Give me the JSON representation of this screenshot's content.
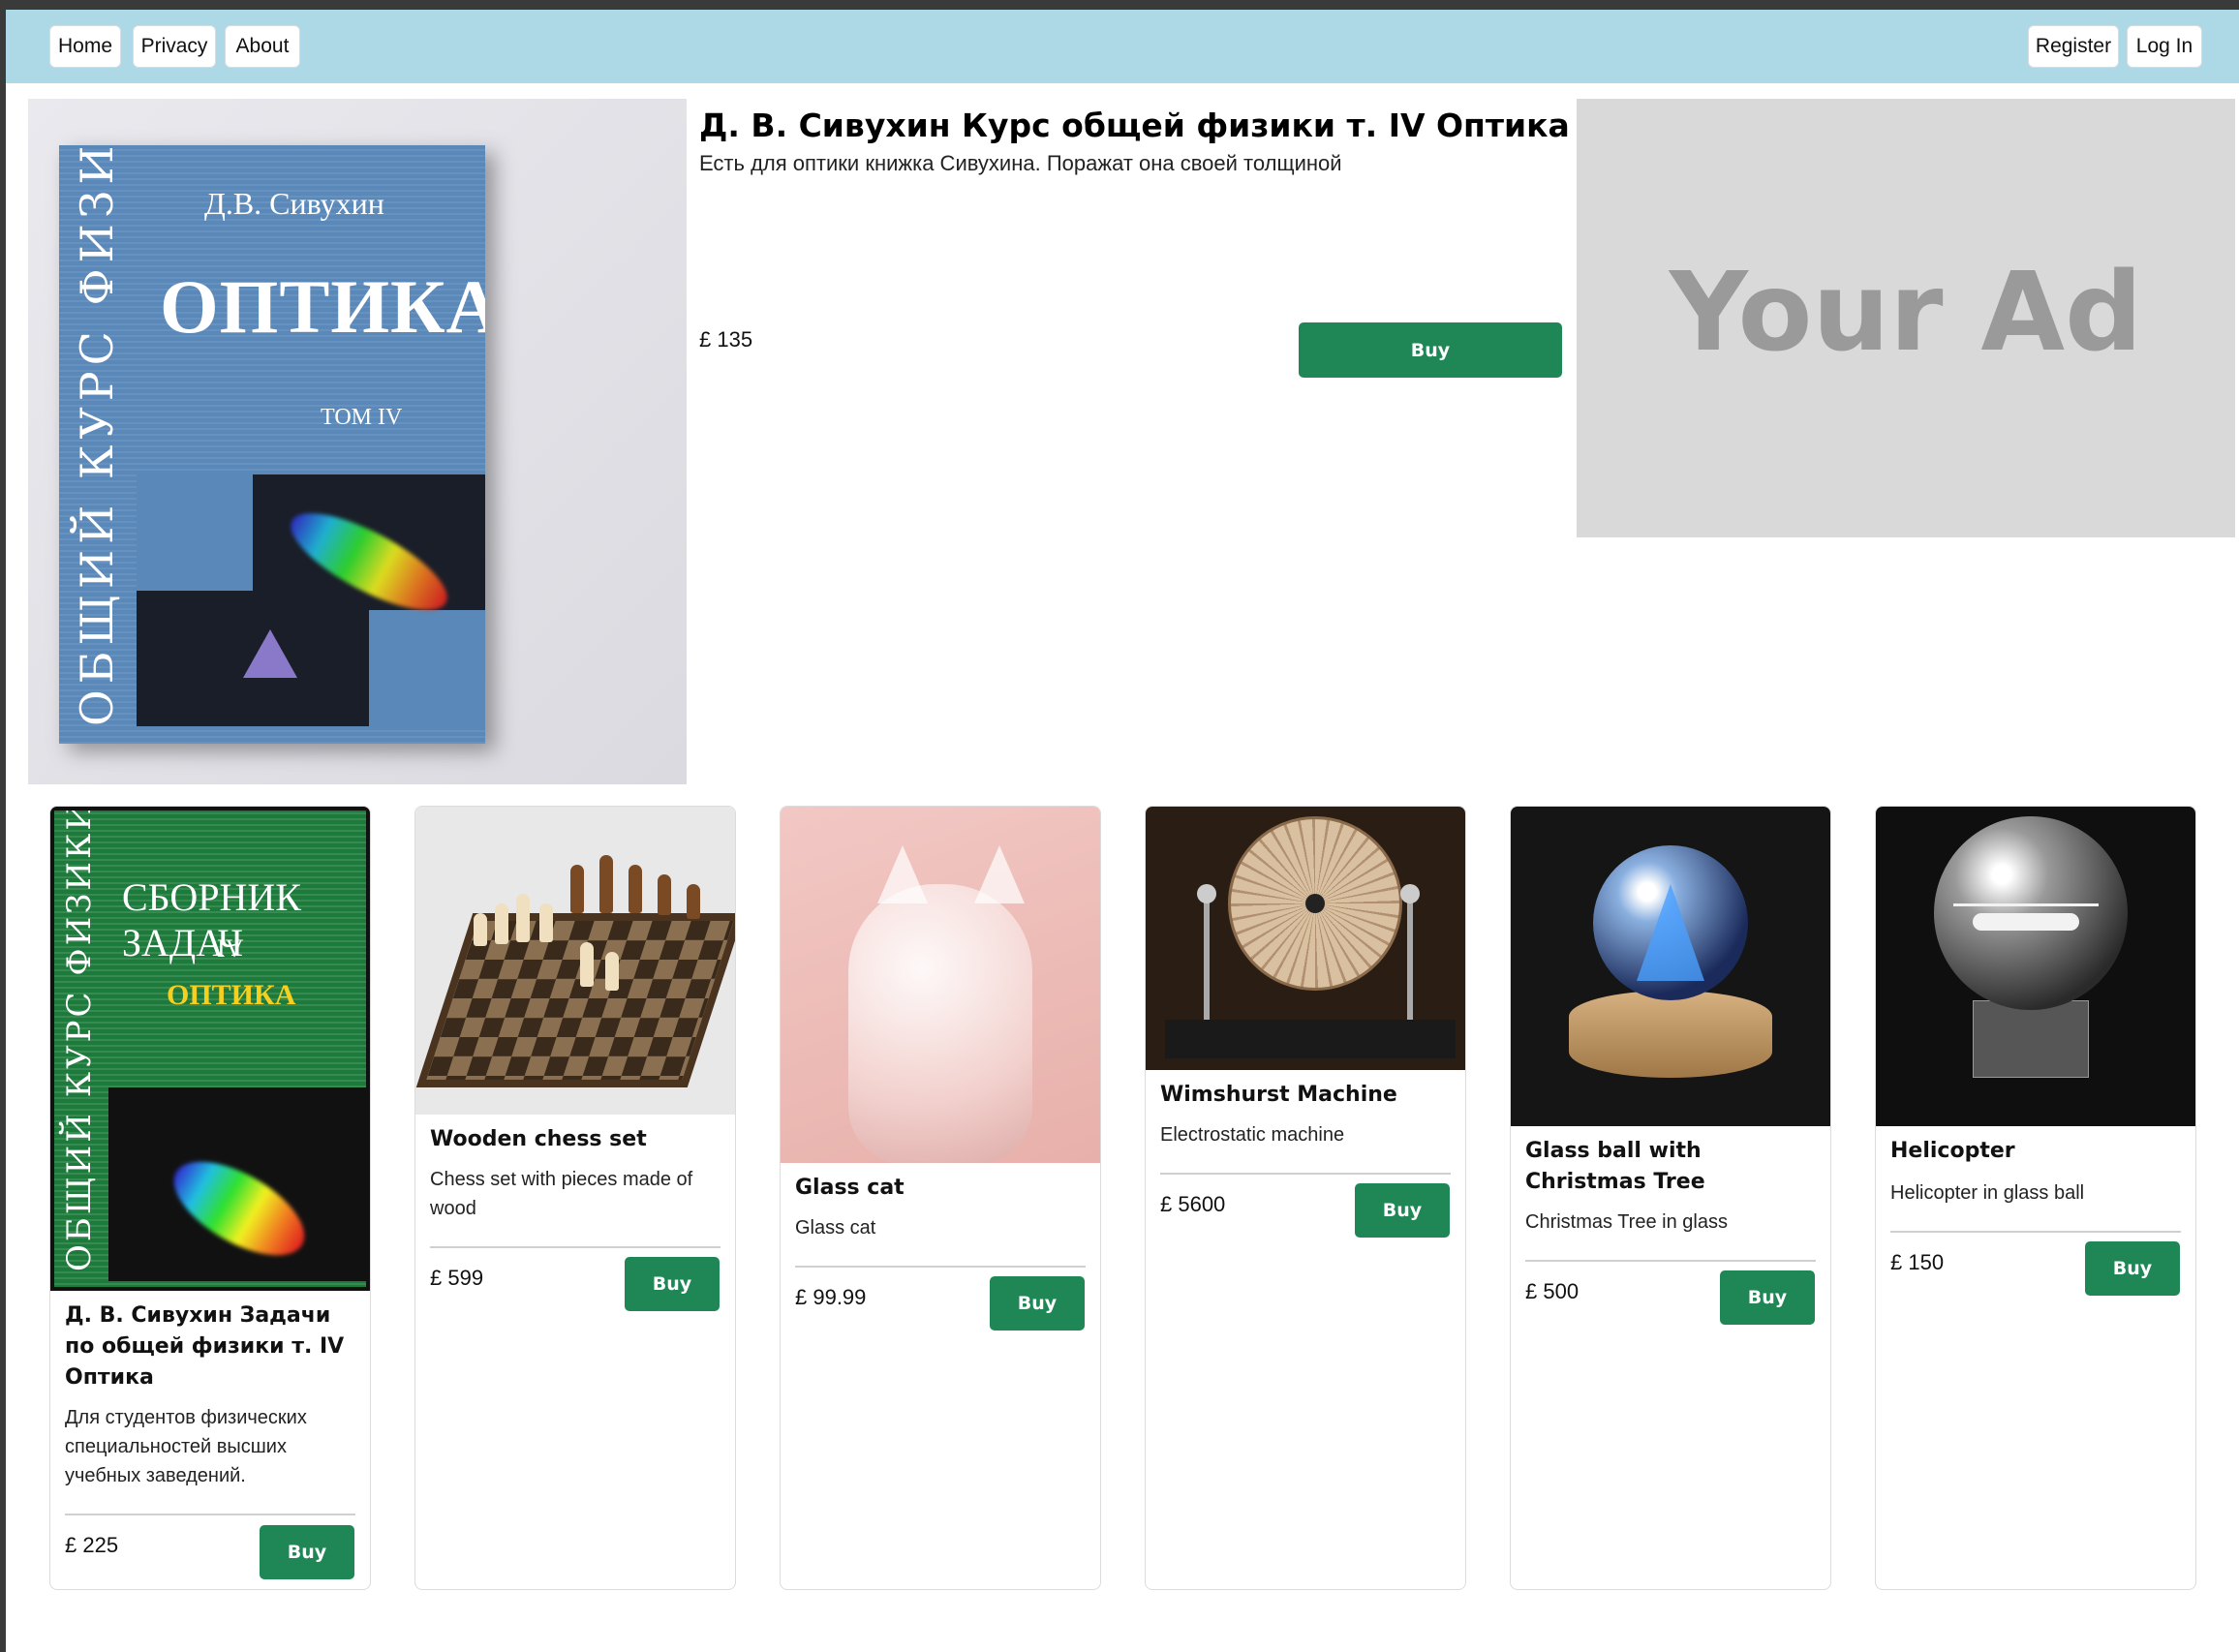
{
  "nav": {
    "home": "Home",
    "privacy": "Privacy",
    "about": "About",
    "register": "Register",
    "login": "Log In"
  },
  "featured": {
    "title": "Д. В. Сивухин Курс общей физики т. IV Оптика",
    "description": "Есть для оптики книжка Сивухина. Поражат она своей толщиной",
    "price": "£ 135",
    "buy_label": "Buy",
    "cover": {
      "spine": "ОБЩИЙ КУРС ФИЗИКИ",
      "author": "Д.В. Сивухин",
      "title": "ОПТИКА",
      "volume": "ТОМ IV"
    }
  },
  "ad": {
    "text": "Your Ad"
  },
  "products": [
    {
      "name": "Д. В. Сивухин Задачи по общей физики т. IV Оптика",
      "description": "Для студентов физических специальностей высших учебных заведений.",
      "price": "£ 225",
      "buy_label": "Buy",
      "cover": {
        "spine": "ОБЩИЙ КУРС ФИЗИКИ",
        "t1": "СБОРНИК ЗАДАЧ",
        "t2": "IV",
        "t3": "ОПТИКА"
      }
    },
    {
      "name": "Wooden chess set",
      "description": "Chess set with pieces made of wood",
      "price": "£ 599",
      "buy_label": "Buy"
    },
    {
      "name": "Glass cat",
      "description": "Glass cat",
      "price": "£ 99.99",
      "buy_label": "Buy"
    },
    {
      "name": "Wimshurst Machine",
      "description": "Electrostatic machine",
      "price": "£ 5600",
      "buy_label": "Buy"
    },
    {
      "name": "Glass ball with Christmas Tree",
      "description": "Christmas Tree in glass",
      "price": "£ 500",
      "buy_label": "Buy"
    },
    {
      "name": "Helicopter",
      "description": "Helicopter in glass ball",
      "price": "£ 150",
      "buy_label": "Buy"
    }
  ],
  "colors": {
    "navbar": "#add8e6",
    "buy_button": "#1e8755",
    "ad_background": "#d9d9d9",
    "ad_text": "#9a9a9a"
  }
}
